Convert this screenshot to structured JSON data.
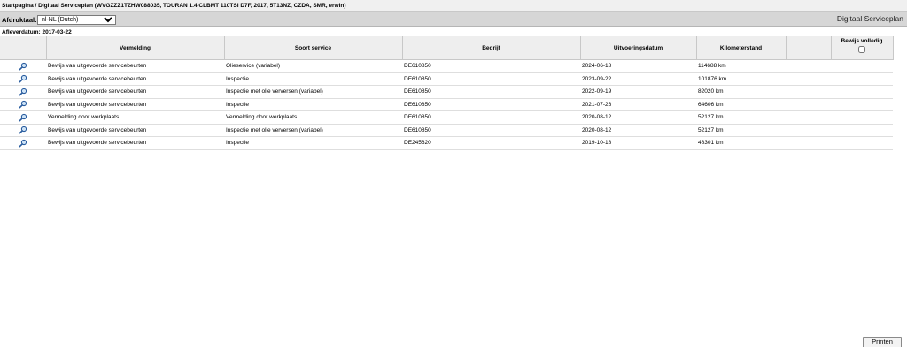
{
  "header": {
    "breadcrumb": "Startpagina / Digitaal Serviceplan (WVGZZZ1TZHW088035, TOURAN 1.4 CLBMT 110TSI D7F, 2017, 5T13NZ, CZDA, SMR, erwin)"
  },
  "toolbar": {
    "language_label": "Afdruktaal:",
    "language_value": "nl-NL (Dutch)",
    "app_title": "Digitaal Serviceplan"
  },
  "delivery": {
    "label": "Afleverdatum: 2017-03-22"
  },
  "table": {
    "columns": {
      "vermelding": "Vermelding",
      "soort": "Soort service",
      "bedrijf": "Bedrijf",
      "datum": "Uitvoeringsdatum",
      "km": "Kilometerstand",
      "bewijs": "Bewijs volledig"
    },
    "rows": [
      {
        "vermelding": "Bewijs van uitgevoerde servicebeurten",
        "soort": "Olieservice (variabel)",
        "bedrijf": "DE610850",
        "datum": "2024-06-18",
        "km": "114688 km"
      },
      {
        "vermelding": "Bewijs van uitgevoerde servicebeurten",
        "soort": "Inspectie",
        "bedrijf": "DE610850",
        "datum": "2023-09-22",
        "km": "101876 km"
      },
      {
        "vermelding": "Bewijs van uitgevoerde servicebeurten",
        "soort": "Inspectie met olie verversen (variabel)",
        "bedrijf": "DE610850",
        "datum": "2022-09-19",
        "km": "82020 km"
      },
      {
        "vermelding": "Bewijs van uitgevoerde servicebeurten",
        "soort": "Inspectie",
        "bedrijf": "DE610850",
        "datum": "2021-07-26",
        "km": "64606 km"
      },
      {
        "vermelding": "Vermelding door werkplaats",
        "soort": "Vermelding door werkplaats",
        "bedrijf": "DE610850",
        "datum": "2020-08-12",
        "km": "52127 km"
      },
      {
        "vermelding": "Bewijs van uitgevoerde servicebeurten",
        "soort": "Inspectie met olie verversen (variabel)",
        "bedrijf": "DE610850",
        "datum": "2020-08-12",
        "km": "52127 km"
      },
      {
        "vermelding": "Bewijs van uitgevoerde servicebeurten",
        "soort": "Inspectie",
        "bedrijf": "DE245620",
        "datum": "2019-10-18",
        "km": "48301 km"
      }
    ]
  },
  "footer": {
    "print_label": "Printen"
  }
}
